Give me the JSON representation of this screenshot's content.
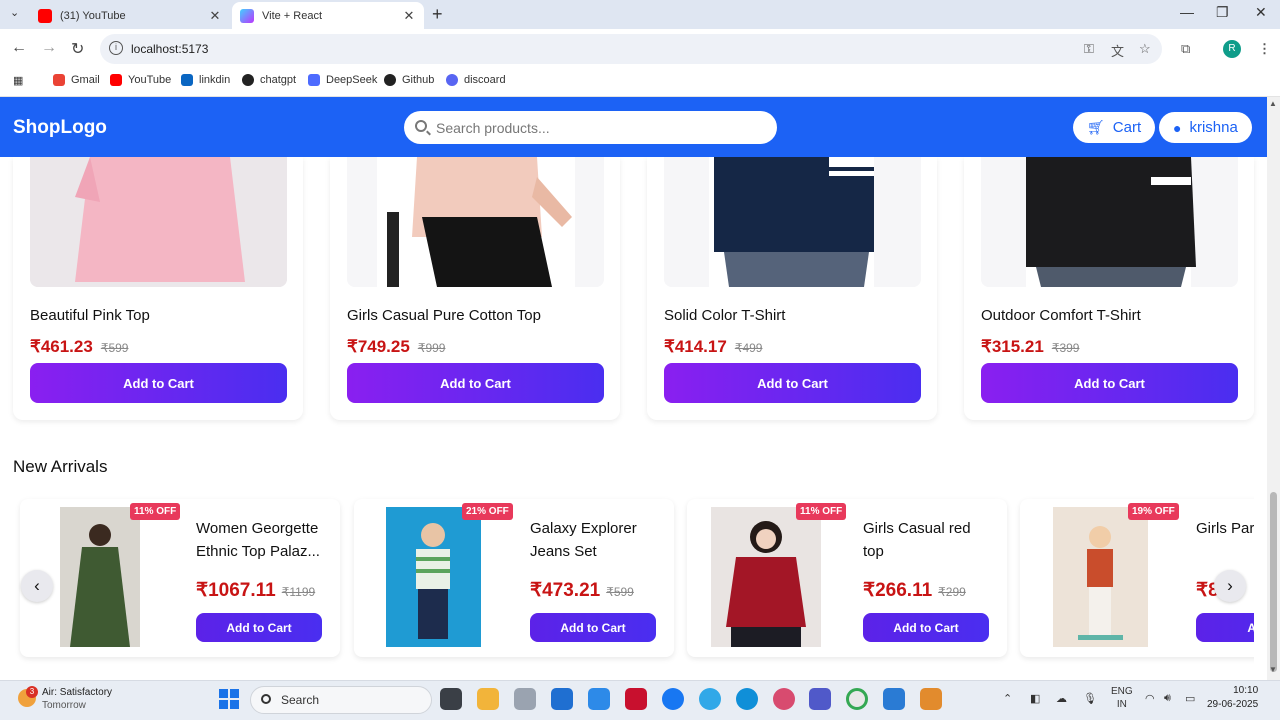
{
  "browser": {
    "tabs": [
      {
        "label": "(31) YouTube",
        "favicon": "youtube-icon",
        "close": "✕"
      },
      {
        "label": "Vite + React",
        "favicon": "vite-icon",
        "close": "✕"
      }
    ],
    "new_tab": "+",
    "url": "localhost:5173",
    "bookmarks": [
      {
        "label": "Gmail",
        "icon": "gmail-icon",
        "color": "#ea4335"
      },
      {
        "label": "YouTube",
        "icon": "youtube-icon",
        "color": "#ff0000"
      },
      {
        "label": "linkdin",
        "icon": "linkedin-icon",
        "color": "#0a66c2"
      },
      {
        "label": "chatgpt",
        "icon": "chatgpt-icon",
        "color": "#222222"
      },
      {
        "label": "DeepSeek",
        "icon": "deepseek-icon",
        "color": "#4d6bfe"
      },
      {
        "label": "Github",
        "icon": "github-icon",
        "color": "#222222"
      },
      {
        "label": "discoard",
        "icon": "discord-icon",
        "color": "#5865f2"
      }
    ],
    "profile_initial": "R"
  },
  "header": {
    "logo": "ShopLogo",
    "search_placeholder": "Search products...",
    "cart_label": "Cart",
    "user_label": "krishna",
    "brand_color": "#1c62f5"
  },
  "products": [
    {
      "name": "Beautiful Pink Top",
      "price": "₹461.23",
      "old_price": "₹599",
      "button": "Add to Cart"
    },
    {
      "name": "Girls Casual Pure Cotton Top",
      "price": "₹749.25",
      "old_price": "₹999",
      "button": "Add to Cart"
    },
    {
      "name": "Solid Color T-Shirt",
      "price": "₹414.17",
      "old_price": "₹499",
      "button": "Add to Cart"
    },
    {
      "name": "Outdoor Comfort T-Shirt",
      "price": "₹315.21",
      "old_price": "₹399",
      "button": "Add to Cart"
    }
  ],
  "new_arrivals": {
    "title": "New Arrivals",
    "items": [
      {
        "name": "Women Georgette Ethnic Top Palaz...",
        "price": "₹1067.11",
        "old_price": "₹1199",
        "badge": "11% OFF",
        "button": "Add to Cart"
      },
      {
        "name": "Galaxy Explorer Jeans Set",
        "price": "₹473.21",
        "old_price": "₹599",
        "badge": "21% OFF",
        "button": "Add to Cart"
      },
      {
        "name": "Girls Casual red top",
        "price": "₹266.11",
        "old_price": "₹299",
        "badge": "11% OFF",
        "button": "Add to Cart"
      },
      {
        "name": "Girls Party Shorts",
        "price": "₹8",
        "old_price": "",
        "badge": "19% OFF",
        "button": "Add"
      }
    ],
    "prev": "‹",
    "next": "›"
  },
  "taskbar": {
    "weather_title": "Air: Satisfactory",
    "weather_sub": "Tomorrow",
    "weather_badge": "3",
    "search_label": "Search",
    "lang_top": "ENG",
    "lang_bottom": "IN",
    "time": "10:10",
    "date": "29-06-2025"
  }
}
